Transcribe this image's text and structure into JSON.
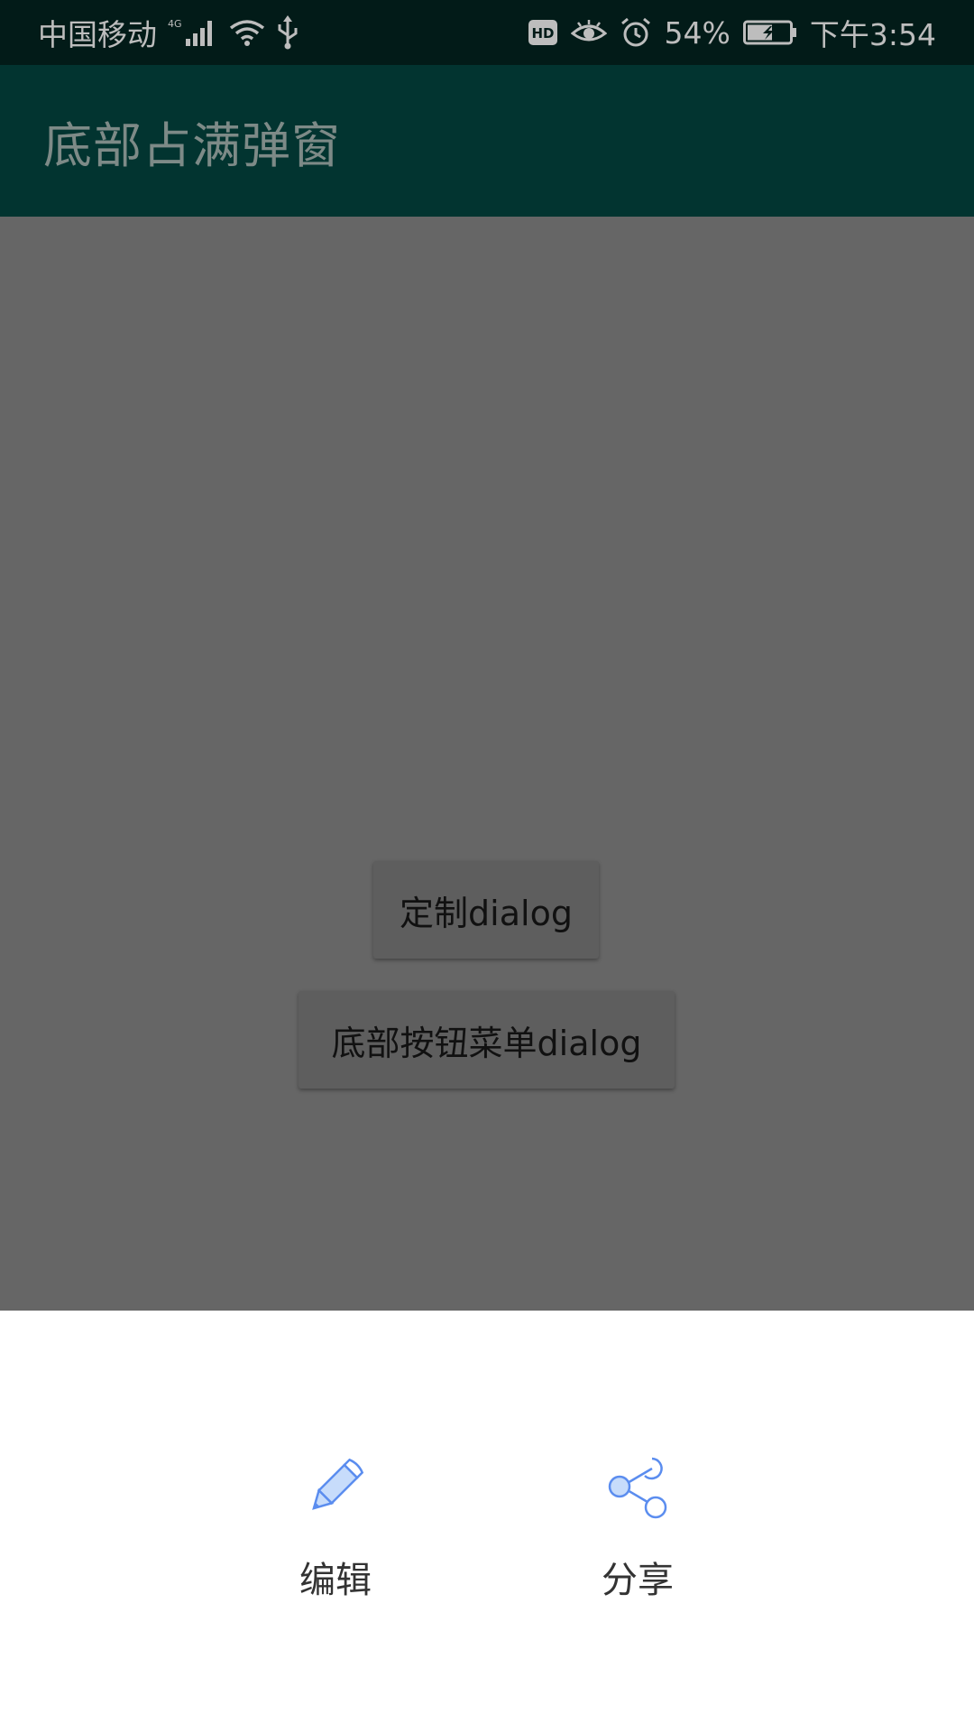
{
  "status_bar": {
    "carrier": "中国移动",
    "network_type": "4G",
    "hd_label": "HD",
    "battery_percent": "54%",
    "time": "下午3:54",
    "icons": [
      "signal-icon",
      "wifi-icon",
      "usb-icon",
      "hd-icon",
      "eye-icon",
      "alarm-icon",
      "battery-icon"
    ]
  },
  "app_bar": {
    "title": "底部占满弹窗"
  },
  "main": {
    "buttons": [
      {
        "label": "定制dialog"
      },
      {
        "label": "底部按钮菜单dialog"
      }
    ]
  },
  "bottom_sheet": {
    "items": [
      {
        "label": "编辑",
        "icon": "pencil-icon"
      },
      {
        "label": "分享",
        "icon": "share-icon"
      }
    ]
  },
  "colors": {
    "status_bar_bg": "#021b18",
    "app_bar_bg": "#023430",
    "scrim": "#666666",
    "sheet_bg": "#ffffff",
    "icon_accent": "#5b8def"
  }
}
